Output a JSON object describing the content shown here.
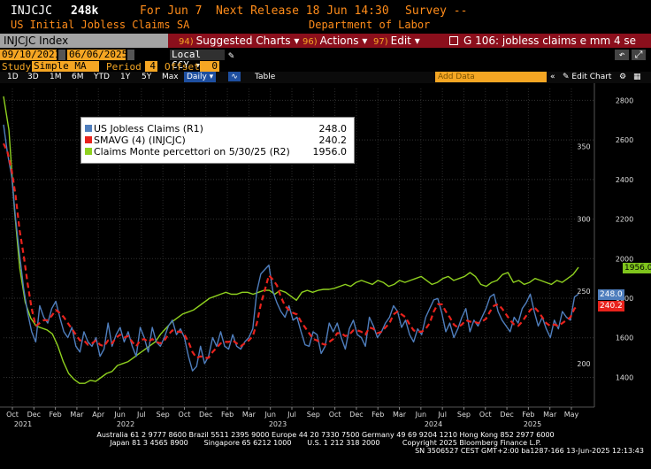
{
  "header": {
    "ticker": "INJCJC",
    "value": "248k",
    "for_label": "For Jun 7",
    "next_release": "Next Release 18 Jun 14:30",
    "survey": "Survey --",
    "description": "US Initial Jobless Claims SA",
    "source": "Department of Labor"
  },
  "command_bar": {
    "security": "INJCJC Index",
    "suggested_num": "94)",
    "suggested": "Suggested Charts",
    "actions_num": "96)",
    "actions": "Actions",
    "edit_num": "97)",
    "edit": "Edit",
    "tile_text": "G 106: jobless claims e mm 4 se"
  },
  "date_row": {
    "start": "09/10/2021",
    "end": "06/06/2025",
    "currency": "Local CCY"
  },
  "study_row": {
    "study_label": "Study",
    "study": "Simple MA",
    "period_label": "Period",
    "period": "4",
    "offset_label": "Offset",
    "offset": "0"
  },
  "tabs": {
    "periods": [
      "1D",
      "3D",
      "1M",
      "6M",
      "YTD",
      "1Y",
      "5Y",
      "Max"
    ],
    "frequency": "Daily",
    "table": "Table",
    "add_data": "Add Data",
    "edit_chart": "Edit Chart"
  },
  "legend": {
    "items": [
      {
        "label": "US Jobless Claims  (R1)",
        "value": "248.0",
        "color": "#4f7ebd"
      },
      {
        "label": "SMAVG (4)  (INJCJC)",
        "value": "240.2",
        "color": "#e8221c"
      },
      {
        "label": "Claims Monte percettori  on 5/30/25 (R2)",
        "value": "1956.0",
        "color": "#8fd11f"
      }
    ]
  },
  "axis_tags": {
    "green": "1956.0",
    "blue": "248.0",
    "red": "240.2"
  },
  "chart_data": {
    "type": "line",
    "x_months": [
      "Oct",
      "Dec",
      "Feb",
      "Mar",
      "Apr",
      "Jun",
      "Jul",
      "Sep",
      "Oct",
      "Dec",
      "Feb",
      "Mar",
      "Jun",
      "Jul",
      "Sep",
      "Oct",
      "Dec",
      "Feb",
      "Mar",
      "Jun",
      "Jul",
      "Sep",
      "Oct",
      "Dec",
      "Feb",
      "Mar",
      "May"
    ],
    "x_years": [
      "2021",
      "2022",
      "2023",
      "2024",
      "2025"
    ],
    "left_axis": {
      "ticks": [
        200,
        250,
        300,
        350
      ],
      "range": [
        170,
        390
      ]
    },
    "right_axis": {
      "ticks": [
        1400,
        1600,
        1800,
        2000,
        2200,
        2400,
        2600,
        2800
      ],
      "range": [
        1250,
        2860
      ]
    },
    "series": [
      {
        "name": "US Jobless Claims  (R1)",
        "axis": "left",
        "values": [
          365,
          345,
          330,
          300,
          275,
          252,
          235,
          222,
          215,
          240,
          232,
          228,
          238,
          243,
          232,
          222,
          218,
          225,
          212,
          208,
          222,
          215,
          212,
          218,
          205,
          210,
          228,
          212,
          220,
          225,
          215,
          222,
          212,
          205,
          225,
          218,
          208,
          225,
          215,
          212,
          218,
          226,
          230,
          220,
          224,
          218,
          205,
          195,
          198,
          212,
          200,
          205,
          218,
          212,
          222,
          212,
          210,
          220,
          212,
          210,
          215,
          218,
          224,
          250,
          262,
          265,
          268,
          250,
          242,
          236,
          232,
          240,
          230,
          232,
          222,
          213,
          212,
          222,
          220,
          207,
          212,
          228,
          222,
          228,
          218,
          210,
          224,
          230,
          220,
          218,
          212,
          232,
          226,
          218,
          222,
          228,
          232,
          240,
          236,
          225,
          230,
          220,
          215,
          224,
          220,
          232,
          238,
          244,
          245,
          235,
          222,
          228,
          218,
          224,
          232,
          238,
          222,
          230,
          226,
          232,
          238,
          246,
          248,
          236,
          230,
          226,
          222,
          232,
          228,
          238,
          242,
          248,
          236,
          226,
          232,
          224,
          218,
          230,
          224,
          236,
          232,
          230,
          246,
          248
        ]
      },
      {
        "name": "SMAVG (4)  (INJCJC)",
        "axis": "left",
        "values": [
          352,
          346,
          334,
          316,
          292,
          275,
          255,
          238,
          226,
          228,
          230,
          230,
          233,
          237,
          235,
          232,
          228,
          224,
          220,
          216,
          216,
          213,
          214,
          216,
          213,
          212,
          216,
          214,
          218,
          220,
          218,
          219,
          215,
          212,
          216,
          217,
          215,
          217,
          215,
          214,
          216,
          220,
          223,
          222,
          222,
          220,
          215,
          208,
          204,
          205,
          204,
          204,
          208,
          211,
          214,
          215,
          215,
          216,
          214,
          212,
          214,
          216,
          219,
          228,
          241,
          251,
          261,
          258,
          254,
          246,
          240,
          237,
          235,
          234,
          229,
          225,
          221,
          217,
          216,
          214,
          213,
          215,
          217,
          221,
          221,
          219,
          220,
          223,
          223,
          222,
          220,
          225,
          224,
          221,
          222,
          225,
          228,
          234,
          236,
          234,
          232,
          227,
          223,
          222,
          222,
          224,
          228,
          236,
          241,
          241,
          236,
          232,
          227,
          225,
          227,
          230,
          229,
          229,
          228,
          229,
          231,
          236,
          240,
          241,
          238,
          234,
          230,
          227,
          226,
          229,
          233,
          237,
          239,
          236,
          232,
          228,
          226,
          227,
          226,
          228,
          230,
          232,
          238,
          240
        ]
      },
      {
        "name": "Claims Monte percettori  on 5/30/25 (R2)",
        "axis": "right",
        "values": [
          2820,
          2650,
          2250,
          1950,
          1780,
          1700,
          1660,
          1650,
          1640,
          1620,
          1560,
          1480,
          1420,
          1390,
          1370,
          1370,
          1385,
          1380,
          1400,
          1420,
          1430,
          1460,
          1470,
          1480,
          1500,
          1520,
          1540,
          1560,
          1580,
          1620,
          1650,
          1680,
          1700,
          1720,
          1730,
          1740,
          1760,
          1780,
          1800,
          1810,
          1820,
          1830,
          1820,
          1820,
          1830,
          1830,
          1820,
          1830,
          1840,
          1840,
          1820,
          1840,
          1830,
          1810,
          1790,
          1830,
          1840,
          1830,
          1840,
          1845,
          1845,
          1850,
          1860,
          1870,
          1860,
          1880,
          1890,
          1880,
          1870,
          1890,
          1880,
          1860,
          1870,
          1890,
          1880,
          1890,
          1900,
          1910,
          1890,
          1870,
          1880,
          1900,
          1910,
          1890,
          1900,
          1910,
          1930,
          1910,
          1870,
          1860,
          1880,
          1890,
          1920,
          1930,
          1880,
          1890,
          1870,
          1880,
          1900,
          1890,
          1880,
          1870,
          1890,
          1880,
          1900,
          1920,
          1956
        ]
      }
    ]
  },
  "footer": {
    "line1": "Australia 61 2 9777 8600 Brazil 5511 2395 9000 Europe 44 20 7330 7500 Germany 49 69 9204 1210 Hong Kong 852 2977 6000",
    "line2": "Japan 81 3 4565 8900       Singapore 65 6212 1000       U.S. 1 212 318 2000          Copyright 2025 Bloomberg Finance L.P.",
    "line3": "SN 3506527 CEST GMT+2:00 ba1287-166 13-Jun-2025 12:13:43"
  }
}
